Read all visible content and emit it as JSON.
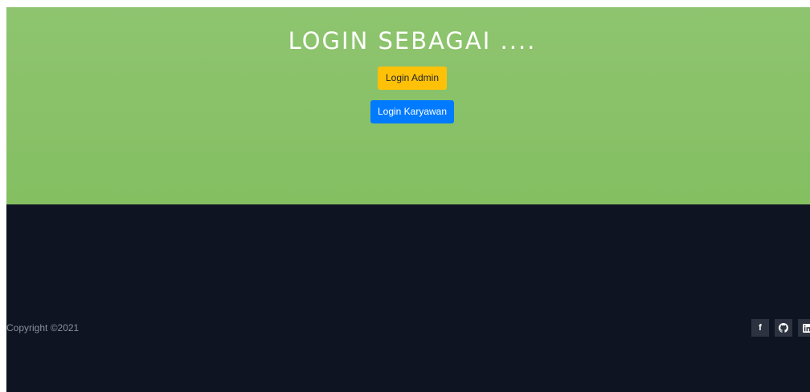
{
  "hero": {
    "title": "LOGIN SEBAGAI ....",
    "background_color": "#8ec46f",
    "buttons": {
      "admin_label": "Login Admin",
      "admin_color": "#ffc107",
      "karyawan_label": "Login Karyawan",
      "karyawan_color": "#007bff"
    }
  },
  "footer": {
    "copyright": "Copyright ©2021",
    "background_color": "#0f1423",
    "social_icons": [
      "facebook-icon",
      "github-icon",
      "linkedin-icon"
    ],
    "facebook_glyph": "f"
  }
}
